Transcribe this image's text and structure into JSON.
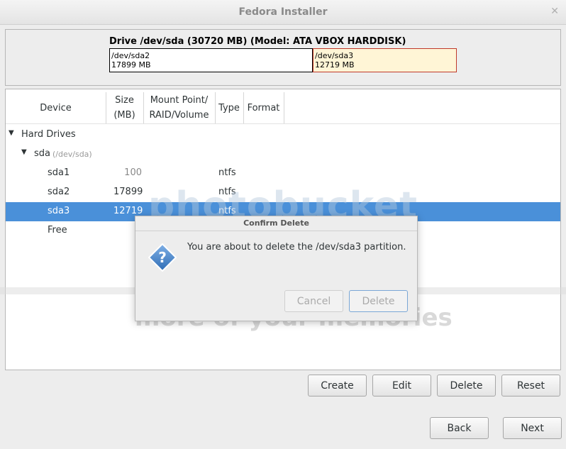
{
  "window": {
    "title": "Fedora Installer",
    "close_glyph": "✕"
  },
  "drive": {
    "title": "Drive /dev/sda (30720 MB) (Model: ATA VBOX HARDDISK)",
    "partitions": [
      {
        "name": "/dev/sda2",
        "size": "17899 MB"
      },
      {
        "name": "/dev/sda3",
        "size": "12719 MB"
      }
    ]
  },
  "table": {
    "headers": {
      "device": "Device",
      "size_line1": "Size",
      "size_line2": "(MB)",
      "mount_line1": "Mount Point/",
      "mount_line2": "RAID/Volume",
      "type": "Type",
      "format": "Format"
    },
    "group": {
      "label": "Hard Drives"
    },
    "disk": {
      "label": "sda",
      "path": "(/dev/sda)"
    },
    "rows": [
      {
        "device": "sda1",
        "size": "100",
        "type": "ntfs"
      },
      {
        "device": "sda2",
        "size": "17899",
        "type": "ntfs"
      },
      {
        "device": "sda3",
        "size": "12719",
        "type": "ntfs"
      },
      {
        "device": "Free",
        "size": "",
        "type": ""
      }
    ]
  },
  "watermark": {
    "line1": "photobucket",
    "line2": "more of your memories"
  },
  "dialog": {
    "title": "Confirm Delete",
    "message": "You are about to delete the /dev/sda3 partition.",
    "cancel": "Cancel",
    "delete": "Delete"
  },
  "actions": {
    "create": "Create",
    "edit": "Edit",
    "delete": "Delete",
    "reset": "Reset"
  },
  "nav": {
    "back": "Back",
    "next": "Next"
  },
  "colors": {
    "selection": "#4a90d9",
    "partition_selected_border": "#c0392b",
    "partition_selected_fill": "#fff5d6"
  }
}
